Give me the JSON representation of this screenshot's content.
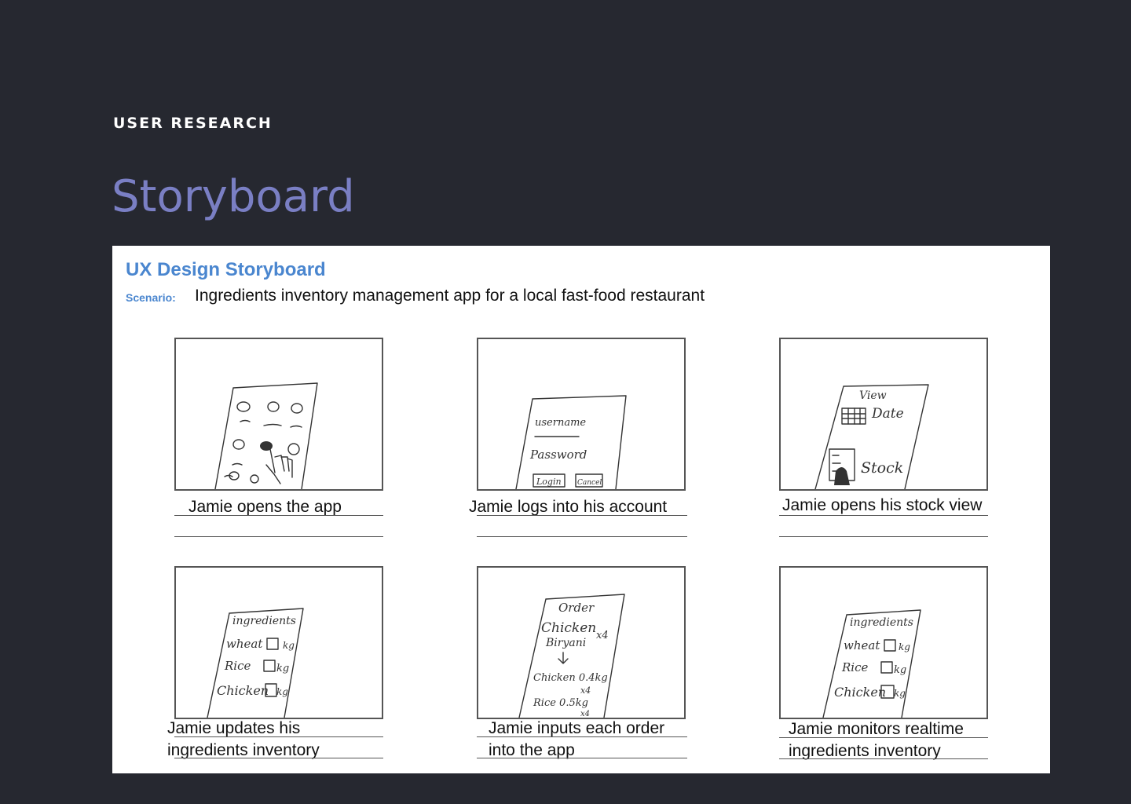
{
  "header": {
    "eyebrow": "USER RESEARCH",
    "title": "Storyboard"
  },
  "storyboard": {
    "heading": "UX Design Storyboard",
    "scenario_label": "Scenario:",
    "scenario_text": "Ingredients inventory management app for a local fast-food restaurant",
    "panels": [
      {
        "caption_lines": [
          "Jamie opens the app",
          ""
        ],
        "sketch_texts": []
      },
      {
        "caption_lines": [
          "Jamie logs into his account",
          ""
        ],
        "sketch_texts": [
          "username",
          "Password",
          "Login",
          "Cancel"
        ]
      },
      {
        "caption_lines": [
          "Jamie opens his stock view",
          ""
        ],
        "sketch_texts": [
          "View",
          "Date",
          "Stock"
        ]
      },
      {
        "caption_lines": [
          "Jamie updates his",
          "ingredients inventory"
        ],
        "sketch_texts": [
          "ingredients",
          "wheat",
          "kg",
          "Rice",
          "kg",
          "Chicken",
          "kg"
        ]
      },
      {
        "caption_lines": [
          "Jamie inputs each order",
          "into the app"
        ],
        "sketch_texts": [
          "Order",
          "Chicken",
          "Biryani",
          "x4",
          "Chicken 0.4kg",
          "x4",
          "Rice 0.5kg",
          "x4"
        ]
      },
      {
        "caption_lines": [
          "Jamie monitors realtime",
          "ingredients inventory"
        ],
        "sketch_texts": [
          "ingredients",
          "wheat",
          "kg",
          "Rice",
          "kg",
          "Chicken",
          "kg"
        ]
      }
    ]
  },
  "icons": {
    "tap-hand": "hand-pointer-icon"
  },
  "colors": {
    "background": "#262830",
    "title": "#7a7fc4",
    "board_heading": "#4a86cf"
  }
}
